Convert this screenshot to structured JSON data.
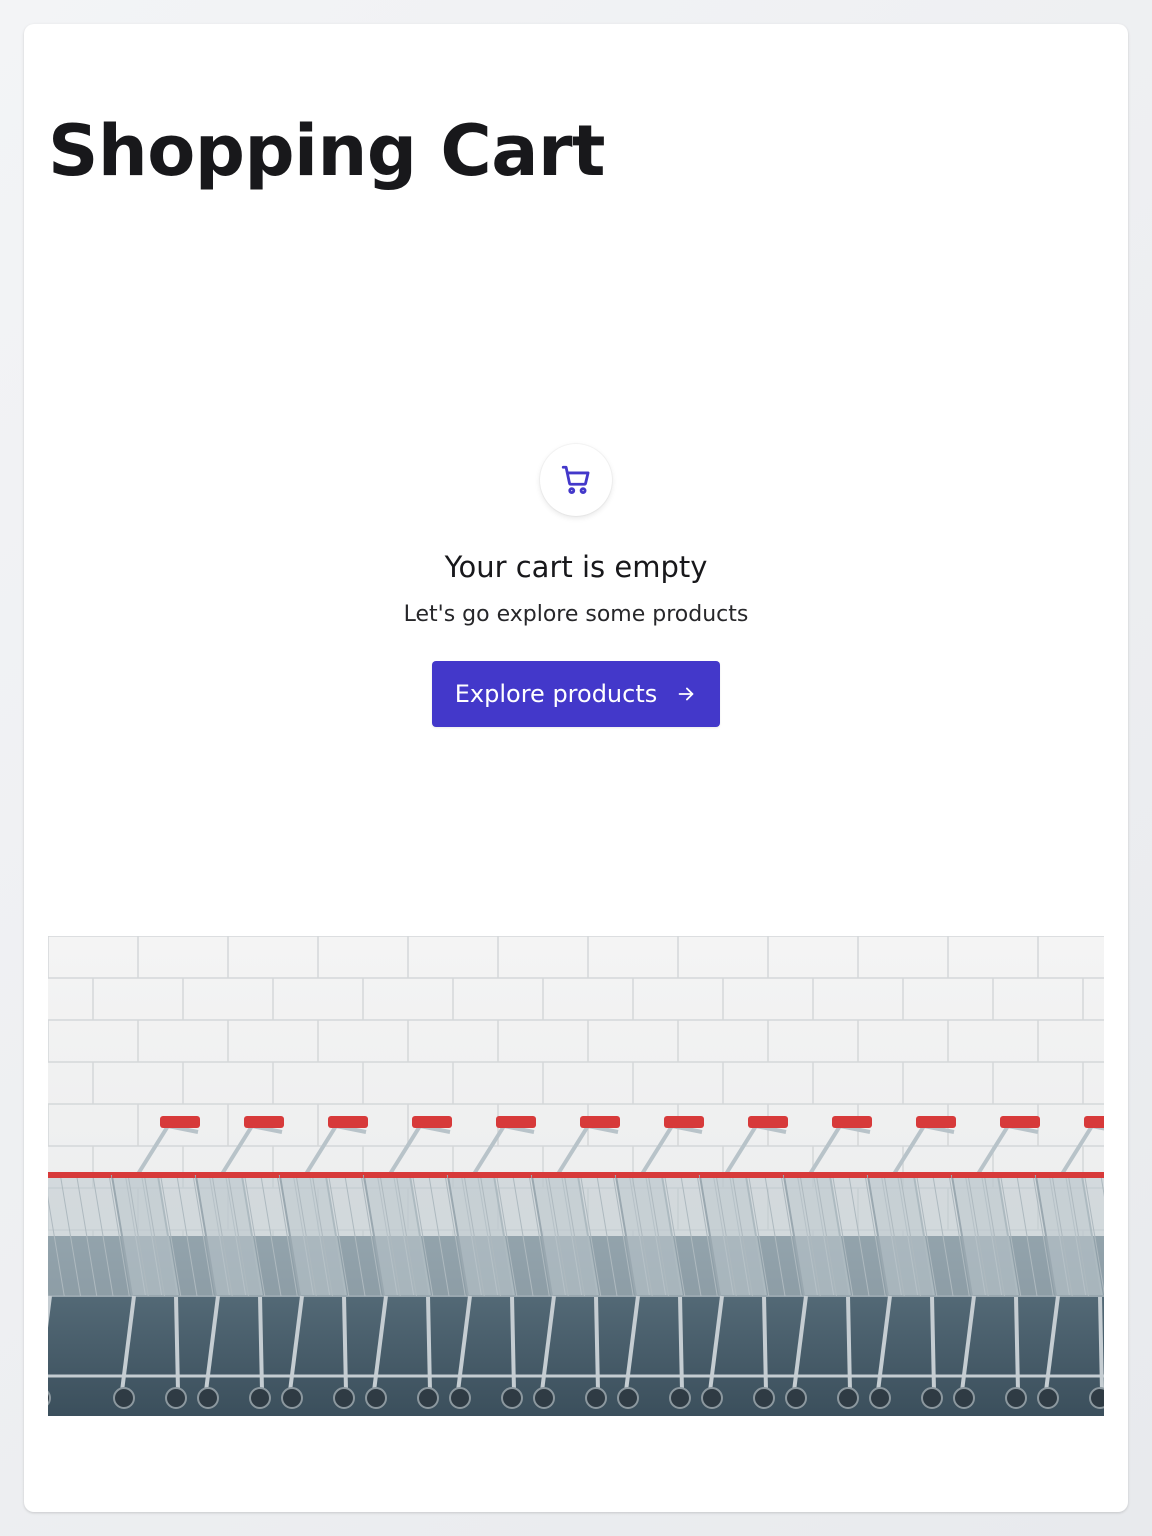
{
  "page": {
    "title": "Shopping Cart"
  },
  "empty_state": {
    "icon": "shopping-cart-icon",
    "heading": "Your cart is empty",
    "subtext": "Let's go explore some products",
    "button_label": "Explore products",
    "button_icon": "arrow-right-icon"
  },
  "image": {
    "subject": "row of shopping carts with red handles against white brick wall"
  },
  "colors": {
    "accent": "#4338ca",
    "cart_handle_red": "#d73a3a",
    "text_primary": "#18181b",
    "background": "#f3f4f6"
  }
}
